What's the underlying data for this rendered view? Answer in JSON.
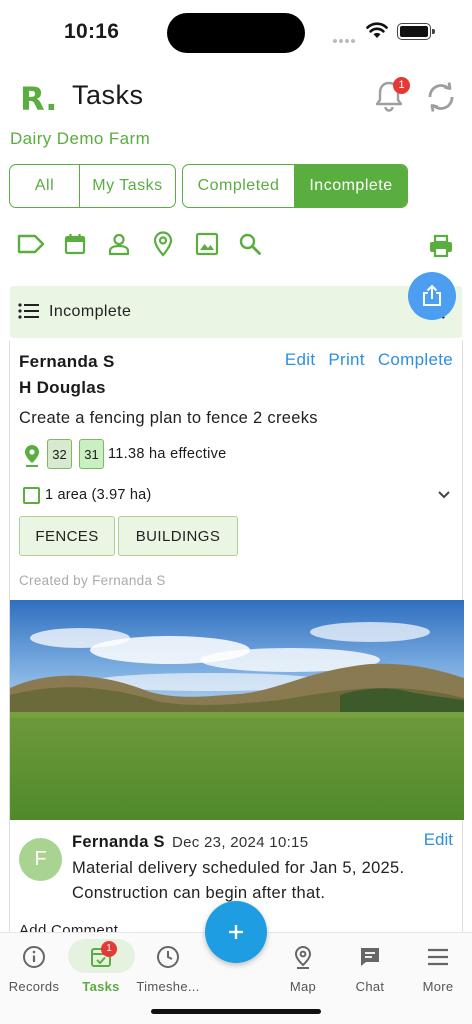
{
  "status_bar": {
    "time": "10:16"
  },
  "header": {
    "logo": "R.",
    "title": "Tasks",
    "notification_count": "1"
  },
  "farm_name": "Dairy Demo Farm",
  "filters": {
    "group1": [
      "All",
      "My Tasks"
    ],
    "group2": [
      "Completed",
      "Incomplete"
    ],
    "active": "Incomplete"
  },
  "tool_icons": [
    "tag-icon",
    "calendar-icon",
    "person-icon",
    "location-pin-icon",
    "image-icon",
    "search-icon",
    "print-icon"
  ],
  "active_filter_chip": {
    "label": "Incomplete"
  },
  "task": {
    "assignees": [
      "Fernanda S",
      "H Douglas"
    ],
    "actions": {
      "edit": "Edit",
      "print": "Print",
      "complete": "Complete"
    },
    "description": "Create a fencing plan to fence 2 creeks",
    "paddocks": [
      "32",
      "31"
    ],
    "effective_area": "11.38 ha effective",
    "area_summary": "1 area (3.97 ha)",
    "tags": [
      "FENCES",
      "BUILDINGS"
    ],
    "created_by": "Created by Fernanda S",
    "comment": {
      "avatar_initial": "F",
      "author": "Fernanda S",
      "date": "Dec 23, 2024 10:15",
      "edit_label": "Edit",
      "text": "Material delivery scheduled for Jan 5, 2025. Construction can begin after that."
    },
    "add_comment_label": "Add Comment"
  },
  "bottom_nav": {
    "items": [
      {
        "label": "Records",
        "icon": "info-icon"
      },
      {
        "label": "Tasks",
        "icon": "calendar-check-icon",
        "badge": "1"
      },
      {
        "label": "Timeshe...",
        "icon": "clock-icon"
      },
      {
        "label": "Map",
        "icon": "map-pin-icon"
      },
      {
        "label": "Chat",
        "icon": "chat-icon"
      },
      {
        "label": "More",
        "icon": "menu-icon"
      }
    ],
    "active": "Tasks"
  },
  "colors": {
    "brand_green": "#5aad3f",
    "link_blue": "#2c8fe0",
    "fab_blue": "#1e9de3",
    "badge_red": "#e53935"
  }
}
